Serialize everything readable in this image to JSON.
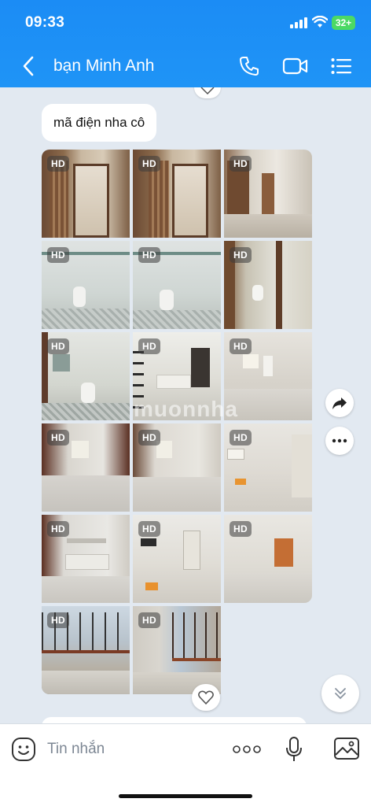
{
  "status_bar": {
    "time": "09:33",
    "battery": "32+"
  },
  "header": {
    "title": "bạn Minh Anh",
    "icons": [
      "back-arrow-icon",
      "phone-icon",
      "video-call-icon",
      "menu-list-icon"
    ]
  },
  "message": {
    "text": "mã điện nha cô"
  },
  "photos": {
    "badge": "HD",
    "count": 17,
    "rows": 6,
    "columns": 3
  },
  "watermark": "muonnha",
  "composer": {
    "placeholder": "Tin nhắn"
  },
  "colors": {
    "header_blue": "#1b8cf5",
    "chat_bg": "#e2e9f1",
    "bubble": "#ffffff"
  }
}
